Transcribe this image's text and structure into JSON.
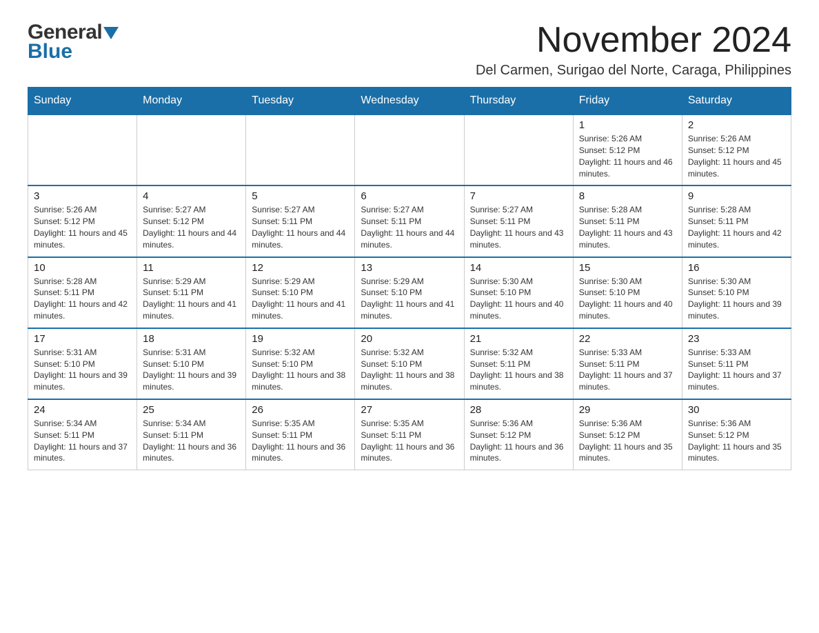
{
  "header": {
    "logo": {
      "general": "General",
      "blue": "Blue",
      "triangle_color": "#1a6fa8"
    },
    "month_year": "November 2024",
    "location": "Del Carmen, Surigao del Norte, Caraga, Philippines"
  },
  "weekdays": [
    "Sunday",
    "Monday",
    "Tuesday",
    "Wednesday",
    "Thursday",
    "Friday",
    "Saturday"
  ],
  "weeks": [
    [
      {
        "day": "",
        "info": ""
      },
      {
        "day": "",
        "info": ""
      },
      {
        "day": "",
        "info": ""
      },
      {
        "day": "",
        "info": ""
      },
      {
        "day": "",
        "info": ""
      },
      {
        "day": "1",
        "info": "Sunrise: 5:26 AM\nSunset: 5:12 PM\nDaylight: 11 hours and 46 minutes."
      },
      {
        "day": "2",
        "info": "Sunrise: 5:26 AM\nSunset: 5:12 PM\nDaylight: 11 hours and 45 minutes."
      }
    ],
    [
      {
        "day": "3",
        "info": "Sunrise: 5:26 AM\nSunset: 5:12 PM\nDaylight: 11 hours and 45 minutes."
      },
      {
        "day": "4",
        "info": "Sunrise: 5:27 AM\nSunset: 5:12 PM\nDaylight: 11 hours and 44 minutes."
      },
      {
        "day": "5",
        "info": "Sunrise: 5:27 AM\nSunset: 5:11 PM\nDaylight: 11 hours and 44 minutes."
      },
      {
        "day": "6",
        "info": "Sunrise: 5:27 AM\nSunset: 5:11 PM\nDaylight: 11 hours and 44 minutes."
      },
      {
        "day": "7",
        "info": "Sunrise: 5:27 AM\nSunset: 5:11 PM\nDaylight: 11 hours and 43 minutes."
      },
      {
        "day": "8",
        "info": "Sunrise: 5:28 AM\nSunset: 5:11 PM\nDaylight: 11 hours and 43 minutes."
      },
      {
        "day": "9",
        "info": "Sunrise: 5:28 AM\nSunset: 5:11 PM\nDaylight: 11 hours and 42 minutes."
      }
    ],
    [
      {
        "day": "10",
        "info": "Sunrise: 5:28 AM\nSunset: 5:11 PM\nDaylight: 11 hours and 42 minutes."
      },
      {
        "day": "11",
        "info": "Sunrise: 5:29 AM\nSunset: 5:11 PM\nDaylight: 11 hours and 41 minutes."
      },
      {
        "day": "12",
        "info": "Sunrise: 5:29 AM\nSunset: 5:10 PM\nDaylight: 11 hours and 41 minutes."
      },
      {
        "day": "13",
        "info": "Sunrise: 5:29 AM\nSunset: 5:10 PM\nDaylight: 11 hours and 41 minutes."
      },
      {
        "day": "14",
        "info": "Sunrise: 5:30 AM\nSunset: 5:10 PM\nDaylight: 11 hours and 40 minutes."
      },
      {
        "day": "15",
        "info": "Sunrise: 5:30 AM\nSunset: 5:10 PM\nDaylight: 11 hours and 40 minutes."
      },
      {
        "day": "16",
        "info": "Sunrise: 5:30 AM\nSunset: 5:10 PM\nDaylight: 11 hours and 39 minutes."
      }
    ],
    [
      {
        "day": "17",
        "info": "Sunrise: 5:31 AM\nSunset: 5:10 PM\nDaylight: 11 hours and 39 minutes."
      },
      {
        "day": "18",
        "info": "Sunrise: 5:31 AM\nSunset: 5:10 PM\nDaylight: 11 hours and 39 minutes."
      },
      {
        "day": "19",
        "info": "Sunrise: 5:32 AM\nSunset: 5:10 PM\nDaylight: 11 hours and 38 minutes."
      },
      {
        "day": "20",
        "info": "Sunrise: 5:32 AM\nSunset: 5:10 PM\nDaylight: 11 hours and 38 minutes."
      },
      {
        "day": "21",
        "info": "Sunrise: 5:32 AM\nSunset: 5:11 PM\nDaylight: 11 hours and 38 minutes."
      },
      {
        "day": "22",
        "info": "Sunrise: 5:33 AM\nSunset: 5:11 PM\nDaylight: 11 hours and 37 minutes."
      },
      {
        "day": "23",
        "info": "Sunrise: 5:33 AM\nSunset: 5:11 PM\nDaylight: 11 hours and 37 minutes."
      }
    ],
    [
      {
        "day": "24",
        "info": "Sunrise: 5:34 AM\nSunset: 5:11 PM\nDaylight: 11 hours and 37 minutes."
      },
      {
        "day": "25",
        "info": "Sunrise: 5:34 AM\nSunset: 5:11 PM\nDaylight: 11 hours and 36 minutes."
      },
      {
        "day": "26",
        "info": "Sunrise: 5:35 AM\nSunset: 5:11 PM\nDaylight: 11 hours and 36 minutes."
      },
      {
        "day": "27",
        "info": "Sunrise: 5:35 AM\nSunset: 5:11 PM\nDaylight: 11 hours and 36 minutes."
      },
      {
        "day": "28",
        "info": "Sunrise: 5:36 AM\nSunset: 5:12 PM\nDaylight: 11 hours and 36 minutes."
      },
      {
        "day": "29",
        "info": "Sunrise: 5:36 AM\nSunset: 5:12 PM\nDaylight: 11 hours and 35 minutes."
      },
      {
        "day": "30",
        "info": "Sunrise: 5:36 AM\nSunset: 5:12 PM\nDaylight: 11 hours and 35 minutes."
      }
    ]
  ]
}
